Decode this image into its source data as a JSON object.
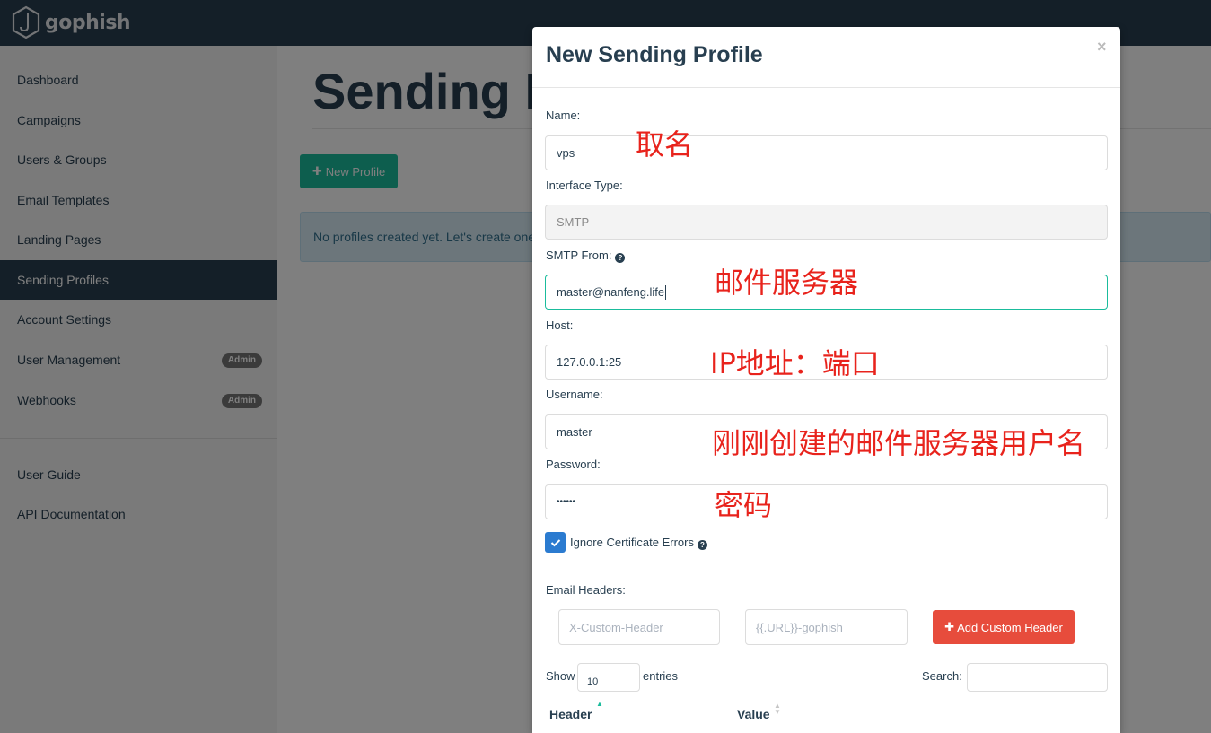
{
  "brand": {
    "name": "gophish",
    "logo_icon": "gophish-hook-logo-icon"
  },
  "sidebar": {
    "items": [
      {
        "label": "Dashboard"
      },
      {
        "label": "Campaigns"
      },
      {
        "label": "Users & Groups"
      },
      {
        "label": "Email Templates"
      },
      {
        "label": "Landing Pages"
      },
      {
        "label": "Sending Profiles",
        "active": true
      },
      {
        "label": "Account Settings"
      },
      {
        "label": "User Management",
        "badge": "Admin"
      },
      {
        "label": "Webhooks",
        "badge": "Admin"
      }
    ],
    "secondary": [
      {
        "label": "User Guide"
      },
      {
        "label": "API Documentation"
      }
    ]
  },
  "main": {
    "title": "Sending Profiles",
    "new_button": "New Profile",
    "empty_alert": "No profiles created yet. Let's create one!"
  },
  "modal": {
    "title": "New Sending Profile",
    "close": "×",
    "name_label": "Name:",
    "name_value": "vps",
    "interface_label": "Interface Type:",
    "interface_value": "SMTP",
    "smtp_from_label": "SMTP From:",
    "smtp_from_value": "master@nanfeng.life",
    "host_label": "Host:",
    "host_value": "127.0.0.1:25",
    "username_label": "Username:",
    "username_value": "master",
    "password_label": "Password:",
    "password_value": "••••••",
    "ignore_cert_label": "Ignore Certificate Errors",
    "ignore_cert_checked": true,
    "headers_label": "Email Headers:",
    "header_placeholder": "X-Custom-Header",
    "value_placeholder": "{{.URL}}-gophish",
    "add_header_button": "Add Custom Header",
    "show_label": "Show",
    "show_value": "10",
    "entries_label": "entries",
    "search_label": "Search:",
    "columns": [
      "Header",
      "Value"
    ]
  },
  "annotations": {
    "name": "取名",
    "smtp_from": "邮件服务器",
    "host": "IP地址：端口",
    "username": "刚刚创建的邮件服务器用户名",
    "password": "密码"
  },
  "colors": {
    "navbar": "#283f50",
    "accent_green": "#1abc9c",
    "danger_red": "#e74c3c",
    "checkbox_blue": "#2b7bd0",
    "annotation_red": "#e8231c"
  }
}
